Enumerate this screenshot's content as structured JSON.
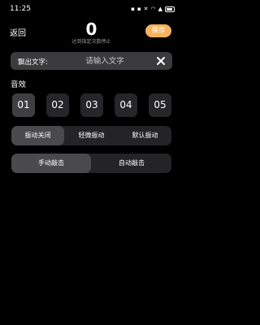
{
  "status_bar": {
    "time": "11:25",
    "icons": [
      "notification-icon",
      "notification-icon",
      "mute-icon",
      "wifi-icon",
      "signal-icon",
      "battery-icon"
    ]
  },
  "header": {
    "back_label": "返回",
    "counter": "0",
    "subtitle": "达到指定次数停止",
    "save_label": "保存"
  },
  "text_input": {
    "label": "飘出文字:",
    "placeholder": "请输入文字"
  },
  "effects": {
    "title": "音效",
    "options": [
      "01",
      "02",
      "03",
      "04",
      "05"
    ]
  },
  "vibration": {
    "options": [
      "振动关闭",
      "轻微振动",
      "默认振动"
    ],
    "selected_index": 0
  },
  "mode": {
    "options": [
      "手动敲击",
      "自动敲击"
    ],
    "selected_index": 0
  },
  "colors": {
    "background": "#000000",
    "accent": "#f6b25e",
    "panel": "#3b3b3d"
  }
}
